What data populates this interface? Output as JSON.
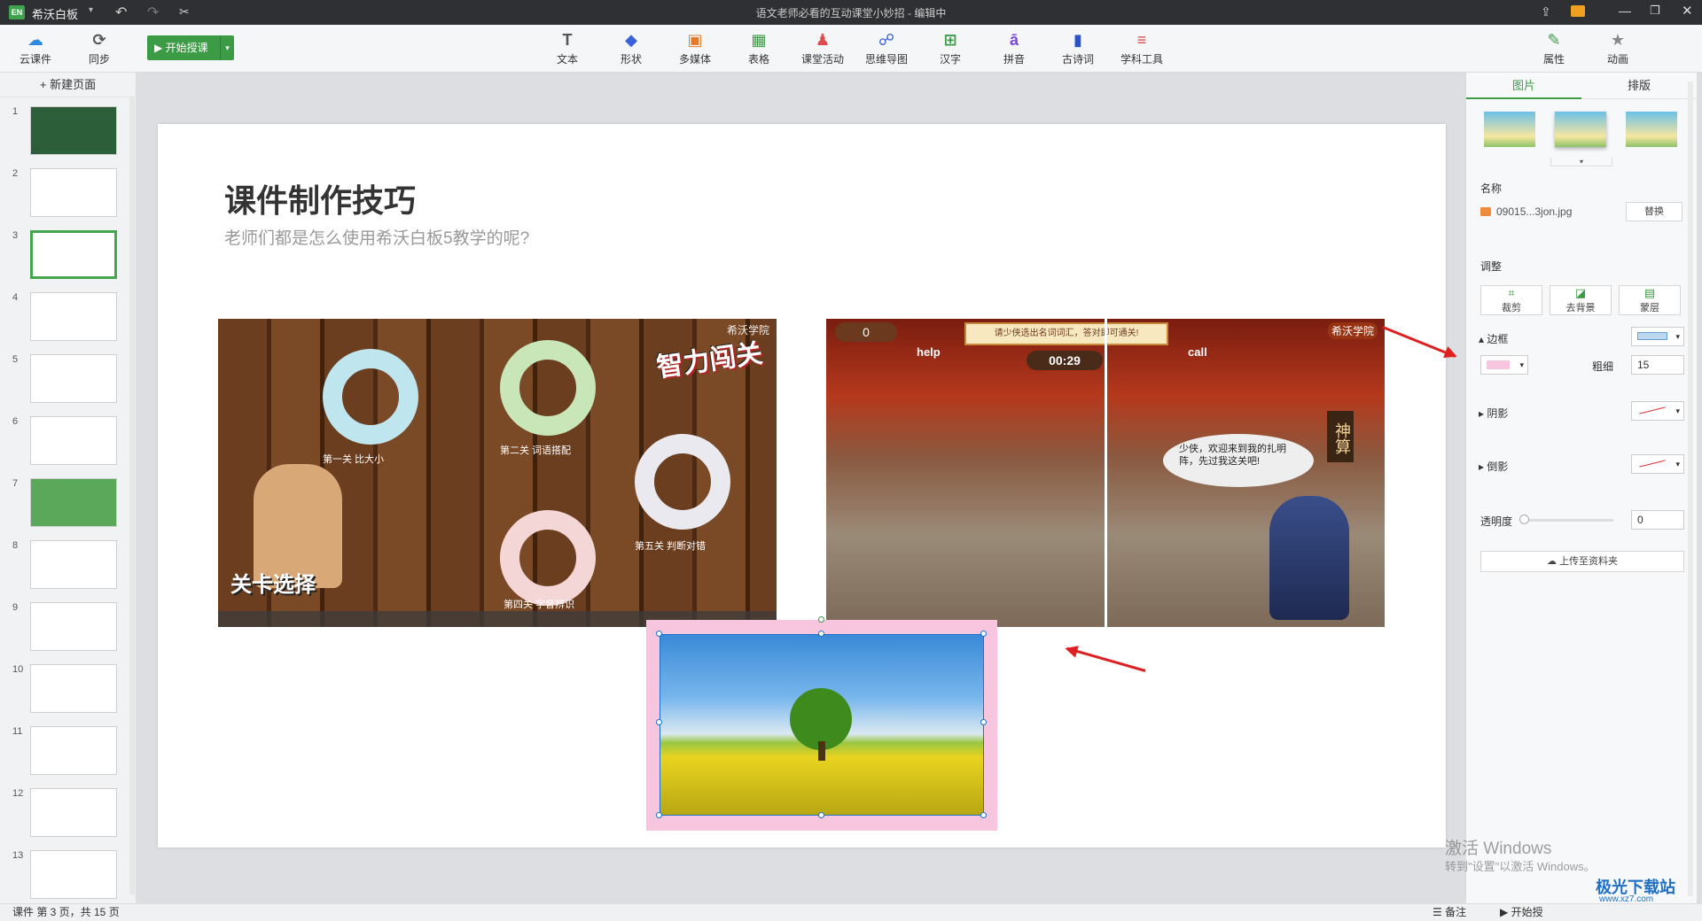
{
  "titlebar": {
    "logo": "EN",
    "app_name": "希沃白板",
    "doc_title": "语文老师必看的互动课堂小妙招 - 编辑中"
  },
  "toolbar": {
    "cloud": "云课件",
    "sync": "同步",
    "start": "开始授课",
    "tools": [
      "文本",
      "形状",
      "多媒体",
      "表格",
      "课堂活动",
      "思维导图",
      "汉字",
      "拼音",
      "古诗词",
      "学科工具"
    ],
    "props": "属性",
    "anim": "动画"
  },
  "left": {
    "new_page": "+ 新建页面",
    "pages": [
      "1",
      "2",
      "3",
      "4",
      "5",
      "6",
      "7",
      "8",
      "9",
      "10",
      "11",
      "12",
      "13"
    ],
    "active_page": 3
  },
  "slide": {
    "title": "课件制作技巧",
    "subtitle": "老师们都是怎么使用希沃白板5教学的呢?",
    "img1": {
      "watermark": "希沃学院",
      "badge": "智力闯关",
      "rings": [
        "第一关 比大小",
        "第二关 词语搭配",
        "第五关 判断对错",
        "第四关 字音辨识"
      ],
      "caption": "关卡选择"
    },
    "img2": {
      "watermark": "希沃学院",
      "score": "0",
      "banner": "请少侠选出名词词汇，答对即可通关!",
      "timer": "00:29",
      "help": "help",
      "call": "call",
      "bubble": "少侠，欢迎来到我的扎明阵，先过我这关吧!",
      "sign": "神算"
    }
  },
  "right": {
    "tabs": [
      "图片",
      "排版"
    ],
    "name_label": "名称",
    "file_name": "09015...3jon.jpg",
    "replace": "替换",
    "adjust_label": "调整",
    "adjust_btns": [
      "裁剪",
      "去背景",
      "蒙层"
    ],
    "border_label": "边框",
    "thickness_label": "粗细",
    "thickness_value": "15",
    "shadow_label": "阴影",
    "reflect_label": "倒影",
    "opacity_label": "透明度",
    "opacity_value": "0",
    "upload": "上传至资料夹",
    "border_color": "#f7c6de",
    "accent": "#3c9b45"
  },
  "status": {
    "page_info": "课件 第 3 页，共 15 页",
    "notes": "备注",
    "start": "开始授"
  },
  "watermark": {
    "line1": "激活 Windows",
    "line2": "转到\"设置\"以激活 Windows。",
    "site": "极光下载站",
    "url": "www.xz7.com"
  }
}
